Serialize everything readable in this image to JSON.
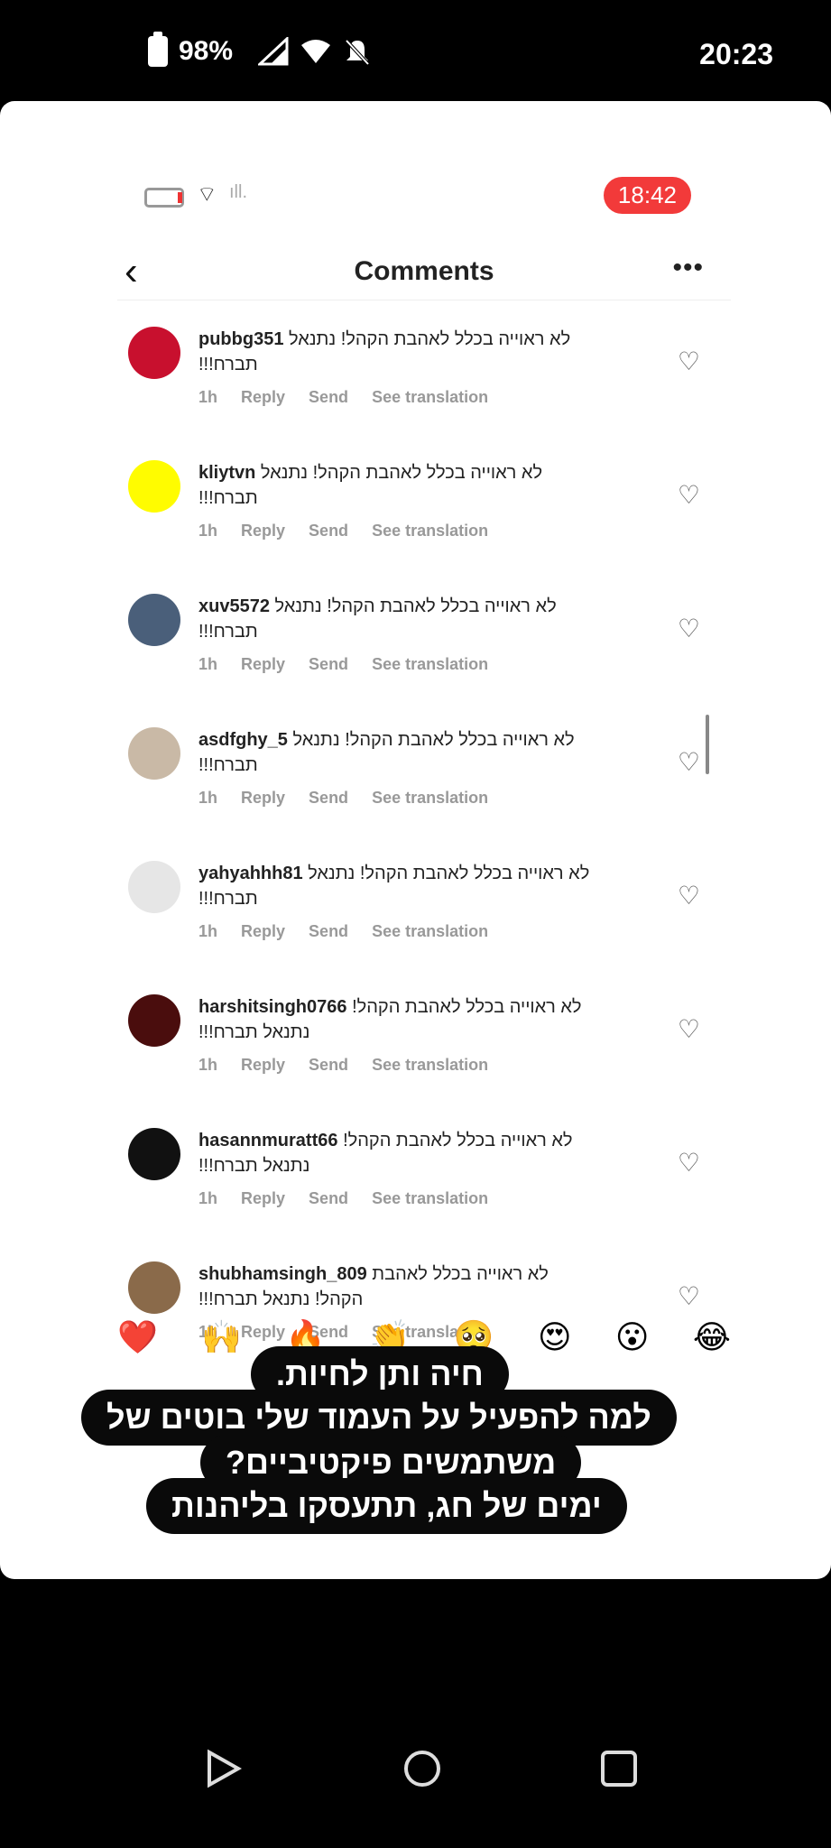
{
  "status_bar": {
    "battery": "98%",
    "time": "20:23"
  },
  "inner_screen": {
    "time_badge": "18:42",
    "header": {
      "back_icon": "chevron-left",
      "title": "Comments",
      "more_label": "•••"
    }
  },
  "comments": [
    {
      "user": "pubbg351",
      "text": "לא ראוייה בכלל לאהבת הקהל! נתנאל תברח!!!",
      "time": "1h",
      "actions": [
        "Reply",
        "Send",
        "See translation"
      ],
      "avatar_color": "#c8102e"
    },
    {
      "user": "kliytvn",
      "text": "לא ראוייה בכלל לאהבת הקהל! נתנאל תברח!!!",
      "time": "1h",
      "actions": [
        "Reply",
        "Send",
        "See translation"
      ],
      "avatar_color": "#fffc00"
    },
    {
      "user": "xuv5572",
      "text": "לא ראוייה בכלל לאהבת הקהל! נתנאל תברח!!!",
      "time": "1h",
      "actions": [
        "Reply",
        "Send",
        "See translation"
      ],
      "avatar_color": "#4a5f7a"
    },
    {
      "user": "asdfghy_5",
      "text": "לא ראוייה בכלל לאהבת הקהל! נתנאל תברח!!!",
      "time": "1h",
      "actions": [
        "Reply",
        "Send",
        "See translation"
      ],
      "avatar_color": "#c9b9a6"
    },
    {
      "user": "yahyahhh81",
      "text": "לא ראוייה בכלל לאהבת הקהל! נתנאל תברח!!!",
      "time": "1h",
      "actions": [
        "Reply",
        "Send",
        "See translation"
      ],
      "avatar_color": "#e6e6e6"
    },
    {
      "user": "harshitsingh0766",
      "text": "לא ראוייה בכלל לאהבת הקהל! נתנאל תברח!!!",
      "time": "1h",
      "actions": [
        "Reply",
        "Send",
        "See translation"
      ],
      "avatar_color": "#4a0d0d"
    },
    {
      "user": "hasannmuratt66",
      "text": "לא ראוייה בכלל לאהבת הקהל! נתנאל תברח!!!",
      "time": "1h",
      "actions": [
        "Reply",
        "Send",
        "See translation"
      ],
      "avatar_color": "#111111"
    },
    {
      "user": "shubhamsingh_809",
      "text": "לא ראוייה בכלל לאהבת הקהל! נתנאל תברח!!!",
      "time": "1h",
      "actions": [
        "Reply",
        "Send",
        "See translation"
      ],
      "avatar_color": "#8a6a4a"
    }
  ],
  "emojis": [
    "❤️",
    "🙌",
    "🔥",
    "👏",
    "🥺",
    "😍",
    "😮",
    "😂"
  ],
  "caption_lines": [
    "חיה ותן לחיות.",
    "למה להפעיל על העמוד שלי בוטים של",
    "משתמשים פיקטיביים?",
    "ימים של חג, תתעסקו בליהנות"
  ],
  "nav": {
    "back": "back-triangle",
    "home": "home-circle",
    "recents": "recents-square"
  }
}
